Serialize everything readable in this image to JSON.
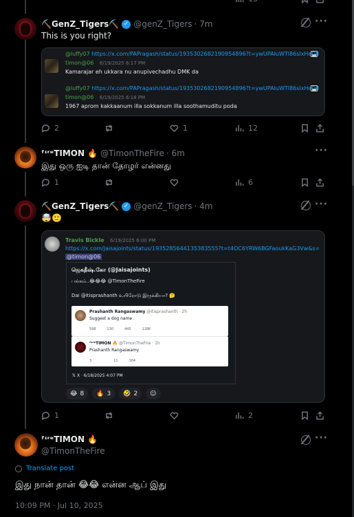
{
  "colors": {
    "accent": "#1d9bf0",
    "muted": "#71767b",
    "text": "#e7e9ea",
    "background": "#000000",
    "quote_green": "#4ba14b"
  },
  "top_actions": {
    "stat": "13"
  },
  "post1": {
    "name": "⛏️GenZ_Tigers⛏️",
    "handle": "@genZ_Tigers",
    "time": "· 7m",
    "text": "This is you right?",
    "quote": {
      "rows": [
        {
          "user": "@luffy07",
          "url": "https://x.com/PAPragash/status/193530268219095489​6?t=ywUPAIuWTl86slxHeD8SAQ&s=19",
          "author": "timon@06",
          "date": "6/19/2025 6:17 PM",
          "message": "Kamarajar eh ukkara nu anupivechadhu DMK da"
        },
        {
          "user": "@luffy07",
          "url": "https://x.com/PAPragash/status/193530268219095489​6?t=ywUPAIuWTl86slxHeD8SAQ&s=19",
          "author": "timon@06",
          "date": "6/19/2025 6:18 PM",
          "message": "1967 aprom kakkaanum illa sokkanum illa soothamuditu poda"
        }
      ]
    },
    "stats": {
      "replies": "2",
      "reposts": "",
      "likes": "1",
      "views": "12"
    }
  },
  "post2": {
    "name": "ᶠᶦʳᵉTIMON 🔥",
    "handle": "@TimonTheFire",
    "time": "· 6m",
    "text": "இது ஒரு ஐடி தான் தோழர் என்னது",
    "stats": {
      "replies": "1",
      "reposts": "",
      "likes": "",
      "views": "6"
    }
  },
  "post3": {
    "name": "⛏️GenZ_Tigers⛏️",
    "handle": "@genZ_Tigers",
    "time": "· 4m",
    "text": "🤯🙂",
    "quote": {
      "author": "Travis Bickle",
      "date": "6/19/2025 6:00 PM",
      "url": "https://x.com/Jaisajoints/status/1935285644135383555?t=t4OC6YRW6BGFaoukKaG3Vw&s=19",
      "mention": "@timon@06",
      "shot": {
        "account": "ஜெகதீஷ்.கோ (@Jaisajoints)",
        "line1": "பங்கம்..😂😂😂 @TimonTheFire",
        "line2": "Dai @itisprashanth உயிரோடு இருக்கியா? 🤔",
        "card1": {
          "name": "Prashanth Rangaswamy",
          "handle": "@itisprashanth · 2h",
          "text": "Suggest a dog name .",
          "s1": "598",
          "s2": "130",
          "s3": "445",
          "s4": "128K"
        },
        "card2": {
          "name": "ᶠᶦʳᵉTIMON 🔥",
          "handle": "@TimonTheFire · 1h",
          "text": "Prashanth Rangaswamy",
          "s1": "3",
          "s2": "",
          "s3": "11",
          "s4": "164"
        },
        "footer": "X · 6/18/2025 4:07 PM"
      },
      "reactions": [
        {
          "emoji": "😂",
          "count": "8"
        },
        {
          "emoji": "🔥",
          "count": "3"
        },
        {
          "emoji": "🤣",
          "count": "2"
        }
      ]
    },
    "stats": {
      "replies": "1",
      "reposts": "",
      "likes": "",
      "views": "2"
    }
  },
  "main_post": {
    "name": "ᶠᶦʳᵉTIMON 🔥",
    "handle": "@TimonTheFire",
    "translate": "Translate post",
    "text": "இது நான் தான் 😂😂 என்ன ஆப் இது",
    "timestamp": "10:09 PM · Jul 10, 2025"
  }
}
